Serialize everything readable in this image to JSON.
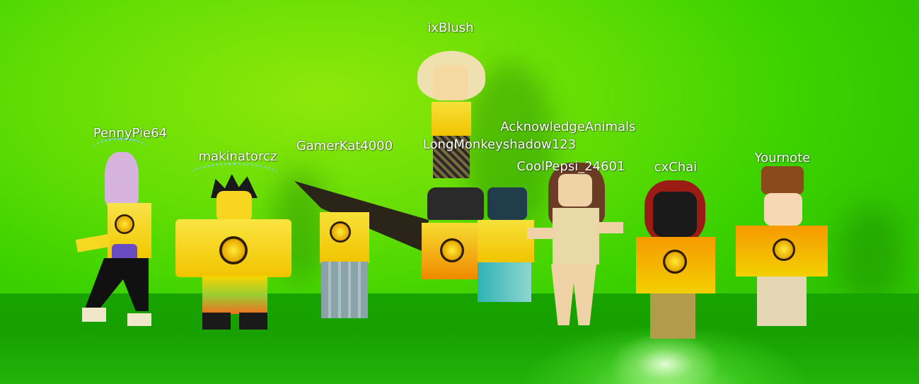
{
  "players": [
    {
      "id": "pennypie64",
      "name": "PennyPie64"
    },
    {
      "id": "makinatorcz",
      "name": "makinatorcz"
    },
    {
      "id": "gamerkat4000",
      "name": "GamerKat4000"
    },
    {
      "id": "ixblush",
      "name": "ixBlush"
    },
    {
      "id": "longmonkeyshadow123",
      "name": "LongMonkeyshadow123"
    },
    {
      "id": "acknowledgeanimals",
      "name": "AcknowledgeAnimals"
    },
    {
      "id": "coolpepsi",
      "name": "CoolPepsi_24601"
    },
    {
      "id": "cxchai",
      "name": "cxChai"
    },
    {
      "id": "yournote",
      "name": "Yournote"
    }
  ],
  "colors": {
    "wall": "#62dd04",
    "floor": "#18a400",
    "shirt_yellow": "#f2d200",
    "shirt_orange": "#f08a00"
  },
  "shirt_icon": "zen-squad-logo"
}
